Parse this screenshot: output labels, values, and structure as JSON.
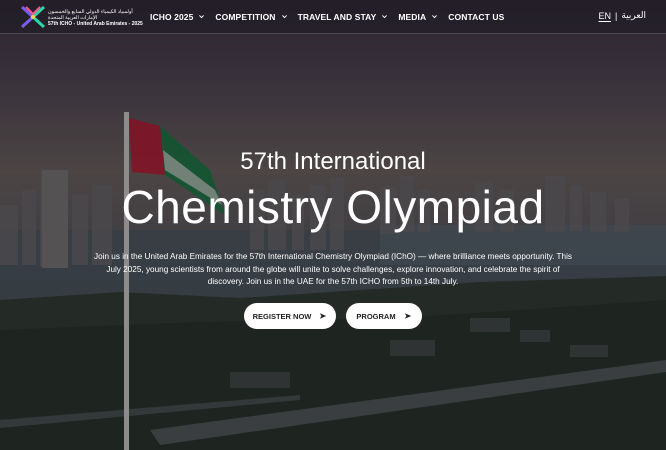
{
  "nav": {
    "logo": {
      "line1": "أولمبياد الكيمياء الدولي السابع والخمسون",
      "line2": "الإمارات العربية المتحدة",
      "line3": "57th ICHO - United Arab Emirates - 2025"
    },
    "items": [
      {
        "label": "ICHO 2025",
        "icon": "chevron-down-icon"
      },
      {
        "label": "COMPETITION",
        "icon": "chevron-down-icon"
      },
      {
        "label": "TRAVEL AND STAY",
        "icon": "chevron-down-icon"
      },
      {
        "label": "MEDIA",
        "icon": "chevron-down-icon"
      },
      {
        "label": "CONTACT US"
      }
    ],
    "lang": {
      "en": "EN",
      "sep": "|",
      "ar": "العربية"
    }
  },
  "hero": {
    "title_small": "57th International",
    "title_large": "Chemistry Olympiad",
    "description": "Join us in the United Arab Emirates for the 57th International Chemistry Olympiad (IChO) — where brilliance meets opportunity. This July 2025, young scientists from around the globe will unite to solve challenges, explore innovation, and celebrate the spirit of discovery. Join us in the UAE for the 57th ICHO from 5th to 14th July.",
    "buttons": [
      {
        "label": "REGISTER NOW",
        "icon": "arrow-right-icon"
      },
      {
        "label": "PROGRAM",
        "icon": "arrow-right-icon"
      }
    ]
  },
  "colors": {
    "button_bg": "#ffffff",
    "text": "#ffffff",
    "flag_red": "#c8102e",
    "flag_green": "#00843d"
  }
}
